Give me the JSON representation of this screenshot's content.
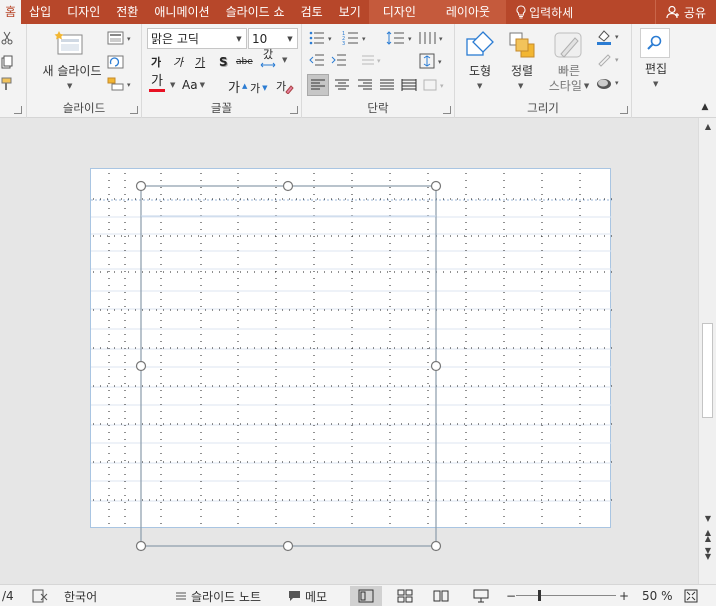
{
  "tabs": {
    "home": "홈",
    "insert": "삽입",
    "design": "디자인",
    "transitions": "전환",
    "animations": "애니메이션",
    "slideshow": "슬라이드 쇼",
    "review": "검토",
    "view": "보기",
    "ctx_design": "디자인",
    "ctx_layout": "레이아웃",
    "tell_me": "입력하세",
    "share": "공유"
  },
  "ribbon": {
    "slides": {
      "new_slide": "새 슬라이드",
      "label": "슬라이드"
    },
    "font": {
      "font_name": "맑은 고딕",
      "font_size": "10",
      "bold": "가",
      "italic": "가",
      "underline": "가",
      "shadow": "S",
      "strike": "abe",
      "spacing": "갔",
      "font_color": "가",
      "case": "Aa",
      "grow": "가",
      "shrink": "가",
      "clear": "가",
      "label": "글꼴"
    },
    "paragraph": {
      "label": "단락"
    },
    "drawing": {
      "shapes": "도형",
      "arrange": "정렬",
      "quick_styles_1": "빠른",
      "quick_styles_2": "스타일",
      "label": "그리기"
    },
    "editing": {
      "label": "편집"
    }
  },
  "status": {
    "slide_num": "/4",
    "language": "한국어",
    "notes": "슬라이드 노트",
    "comments": "메모",
    "zoom": "50 %"
  },
  "colors": {
    "accent": "#b7472a",
    "font_color_bar": "#e81123",
    "slide_border": "#a9c5e2",
    "selection_border": "#8a9bab"
  }
}
